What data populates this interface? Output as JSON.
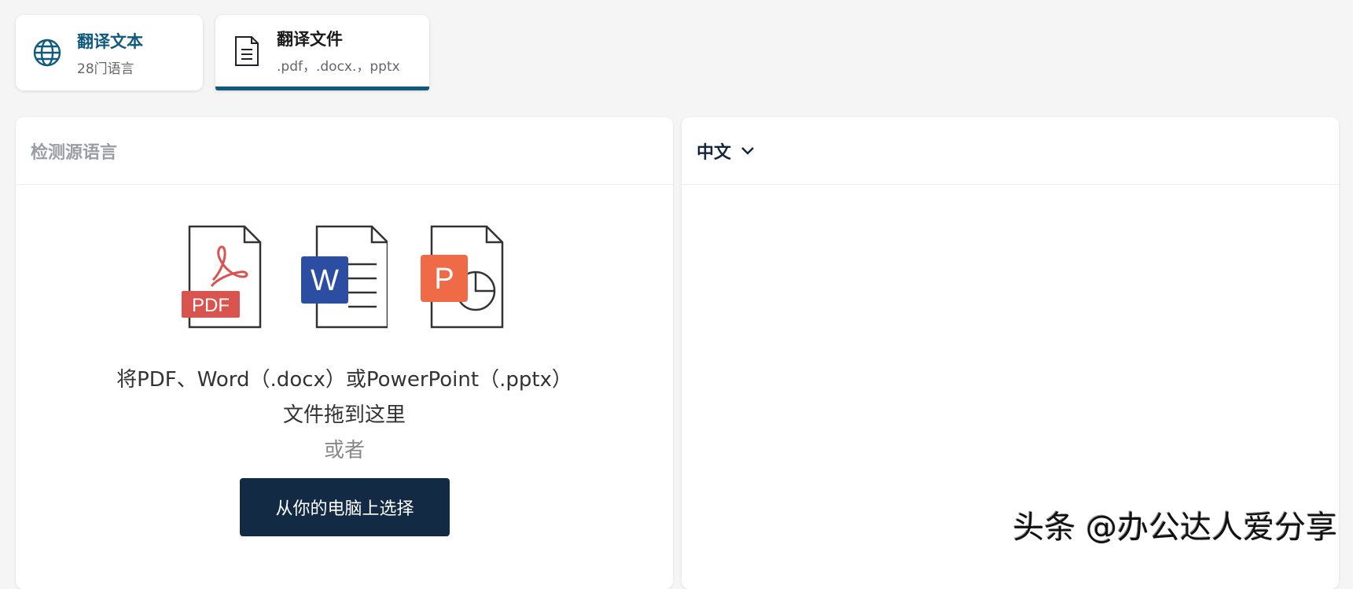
{
  "tabs": [
    {
      "title": "翻译文本",
      "subtitle": "28门语言",
      "icon": "globe-icon"
    },
    {
      "title": "翻译文件",
      "subtitle": ".pdf，.docx.，pptx",
      "icon": "document-icon",
      "active": true
    }
  ],
  "source": {
    "label": "检测源语言"
  },
  "target": {
    "label": "中文",
    "icon": "chevron-down-icon"
  },
  "dropzone": {
    "file_icons": {
      "pdf": "PDF",
      "word": "W",
      "powerpoint": "P"
    },
    "line1": "将PDF、Word（.docx）或PowerPoint（.pptx）",
    "line2": "文件拖到这里",
    "or": "或者",
    "button": "从你的电脑上选择"
  },
  "watermark": "头条 @办公达人爱分享",
  "colors": {
    "accent": "#125a7c",
    "button": "#132a44",
    "pdf": "#d9534f",
    "word": "#2b4ea2",
    "ppt": "#ef6a47"
  }
}
